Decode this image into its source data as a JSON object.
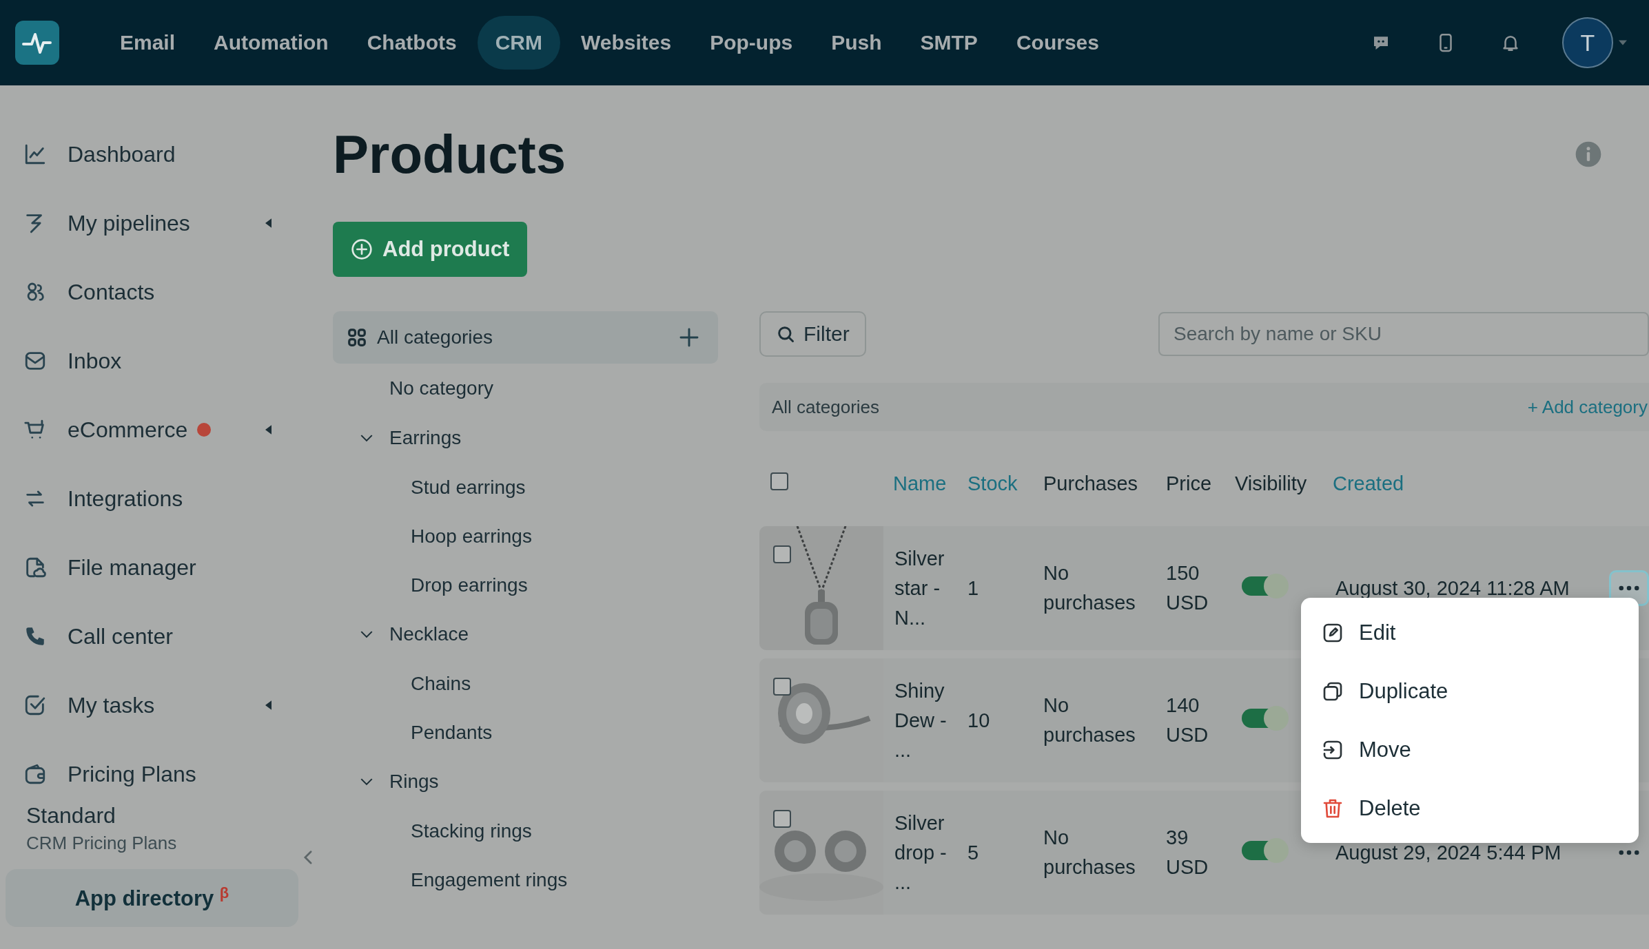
{
  "nav": {
    "items": [
      {
        "label": "Email",
        "selected": false
      },
      {
        "label": "Automation",
        "selected": false
      },
      {
        "label": "Chatbots",
        "selected": false
      },
      {
        "label": "CRM",
        "selected": true
      },
      {
        "label": "Websites",
        "selected": false
      },
      {
        "label": "Pop-ups",
        "selected": false
      },
      {
        "label": "Push",
        "selected": false
      },
      {
        "label": "SMTP",
        "selected": false
      },
      {
        "label": "Courses",
        "selected": false
      }
    ],
    "avatar": "T"
  },
  "sidebar": {
    "items": [
      {
        "label": "Dashboard",
        "expandable": false,
        "notification": false
      },
      {
        "label": "My pipelines",
        "expandable": true,
        "notification": false
      },
      {
        "label": "Contacts",
        "expandable": false,
        "notification": false
      },
      {
        "label": "Inbox",
        "expandable": false,
        "notification": false
      },
      {
        "label": "eCommerce",
        "expandable": true,
        "notification": true
      },
      {
        "label": "Integrations",
        "expandable": false,
        "notification": false
      },
      {
        "label": "File manager",
        "expandable": false,
        "notification": false
      },
      {
        "label": "Call center",
        "expandable": false,
        "notification": false
      },
      {
        "label": "My tasks",
        "expandable": true,
        "notification": false
      },
      {
        "label": "Pricing Plans",
        "expandable": false,
        "notification": false
      }
    ],
    "plan": {
      "name": "Standard",
      "product": "CRM Pricing Plans"
    },
    "app_directory": {
      "label": "App directory",
      "badge": "β"
    }
  },
  "page": {
    "title": "Products",
    "add_button": "Add product"
  },
  "categories": {
    "root": {
      "label": "All categories",
      "selected": true
    },
    "items": [
      {
        "label": "No category"
      },
      {
        "label": "Earrings",
        "expanded": true,
        "children": [
          {
            "label": "Stud earrings"
          },
          {
            "label": "Hoop earrings"
          },
          {
            "label": "Drop earrings"
          }
        ]
      },
      {
        "label": "Necklace",
        "expanded": true,
        "children": [
          {
            "label": "Chains"
          },
          {
            "label": "Pendants"
          }
        ]
      },
      {
        "label": "Rings",
        "expanded": true,
        "children": [
          {
            "label": "Stacking rings"
          },
          {
            "label": "Engagement rings"
          }
        ]
      }
    ]
  },
  "toolbar": {
    "filter": "Filter",
    "search": {
      "placeholder": "Search by name or SKU"
    }
  },
  "breadcrumb": {
    "label": "All categories",
    "add_link": "+ Add category"
  },
  "table": {
    "all_checked": false,
    "columns": [
      {
        "label": "Name",
        "sortable": true
      },
      {
        "label": "Stock",
        "sortable": true
      },
      {
        "label": "Purchases",
        "sortable": false
      },
      {
        "label": "Price",
        "sortable": false
      },
      {
        "label": "Visibility",
        "sortable": false
      },
      {
        "label": "Created",
        "sortable": true
      }
    ],
    "rows": [
      {
        "checked": false,
        "name": "Silver star - N...",
        "stock": "1",
        "purchases": "No purchases",
        "price": "150 USD",
        "visible": true,
        "created": "August 30, 2024 11:28 AM",
        "menu_open": true
      },
      {
        "checked": false,
        "name": "Shiny Dew - ...",
        "stock": "10",
        "purchases": "No purchases",
        "price": "140 USD",
        "visible": true,
        "menu_open": false
      },
      {
        "checked": false,
        "name": "Silver drop - ...",
        "stock": "5",
        "purchases": "No purchases",
        "price": "39 USD",
        "visible": true,
        "created": "August 29, 2024 5:44 PM",
        "menu_open": false
      }
    ]
  },
  "row_menu": {
    "items": [
      {
        "label": "Edit",
        "kind": "edit"
      },
      {
        "label": "Duplicate",
        "kind": "duplicate"
      },
      {
        "label": "Move",
        "kind": "move"
      },
      {
        "label": "Delete",
        "kind": "delete"
      }
    ]
  }
}
